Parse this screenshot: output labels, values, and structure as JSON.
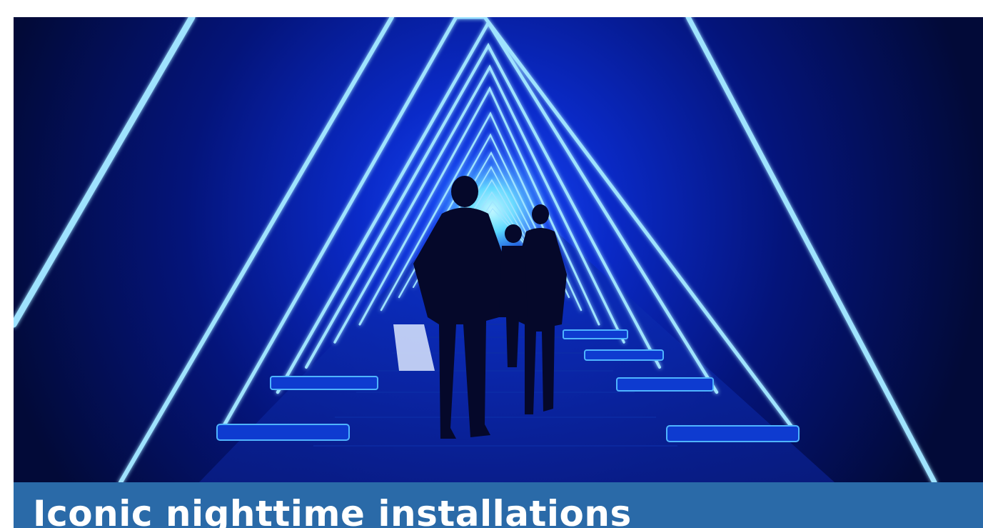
{
  "feature": {
    "image": {
      "subject": "light-tunnel-photo"
    },
    "caption": {
      "title": "Iconic nighttime installations",
      "background_color": "#2a6aa8",
      "text_color": "#ffffff"
    }
  }
}
